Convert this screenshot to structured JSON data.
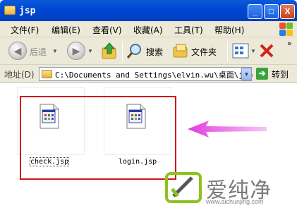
{
  "window": {
    "title": "jsp",
    "buttons": [
      "_",
      "□",
      "X"
    ]
  },
  "menu": [
    "文件(F)",
    "编辑(E)",
    "查看(V)",
    "收藏(A)",
    "工具(T)",
    "帮助(H)"
  ],
  "toolbar": {
    "back_label": "后退",
    "search_label": "搜索",
    "folders_label": "文件夹",
    "overflow": "»"
  },
  "address": {
    "label": "地址(D)",
    "value": "C:\\Documents and Settings\\elvin.wu\\桌面\\jsp",
    "go_label": "转到"
  },
  "files": [
    {
      "name": "check.jsp",
      "selected": true
    },
    {
      "name": "login.jsp",
      "selected": false
    }
  ],
  "watermark": {
    "text": "爱纯净",
    "url": "www.aichunjing.com"
  },
  "colors": {
    "titlebar": "#0046d5",
    "annotation_box": "#d01818",
    "arrow": "#e23ee0"
  }
}
